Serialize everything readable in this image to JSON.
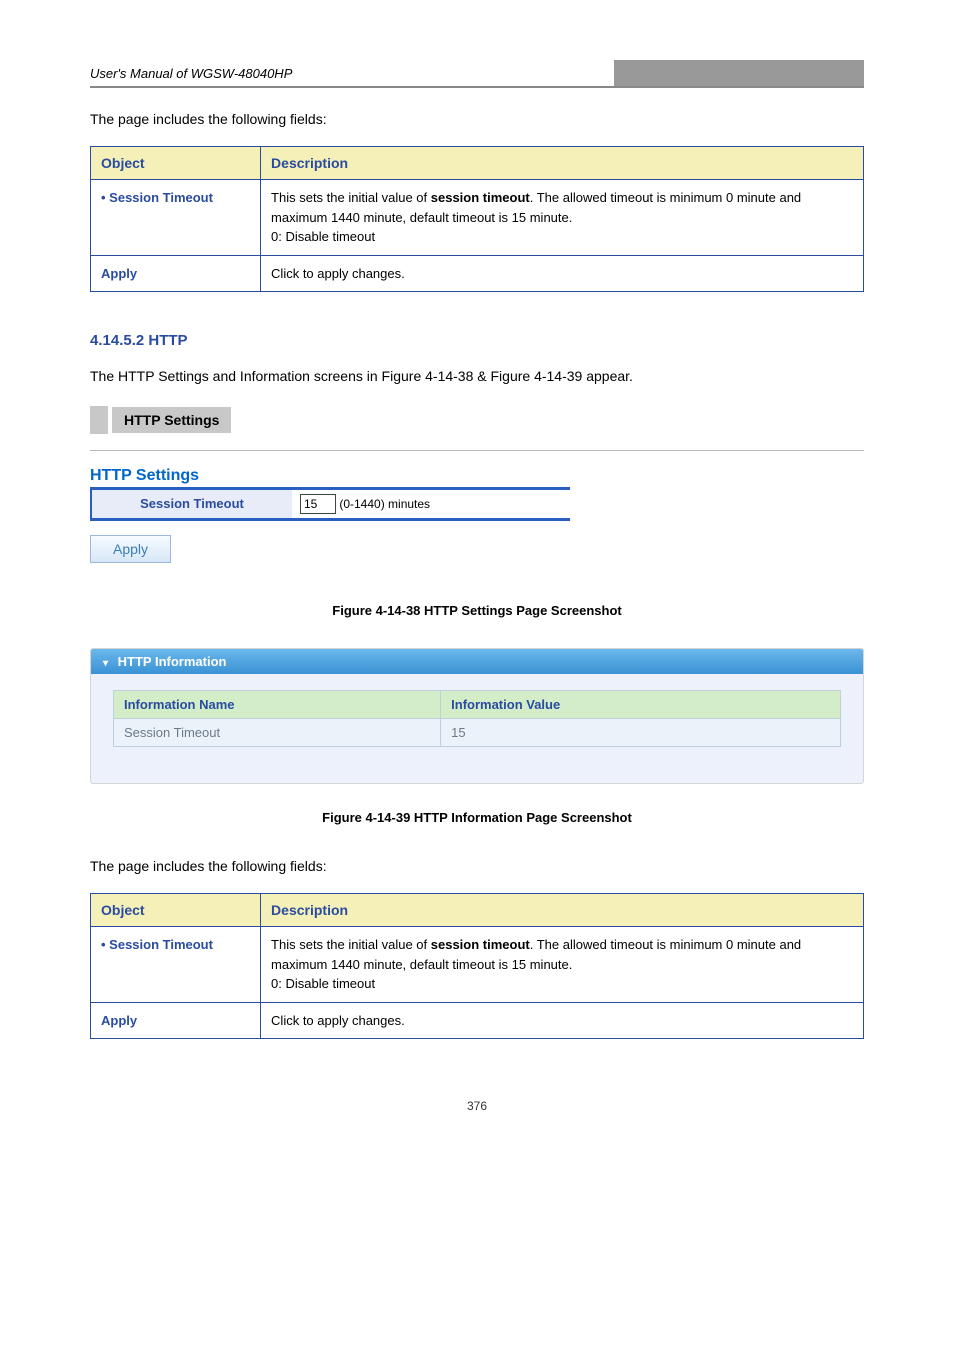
{
  "header": {
    "left_italic": "User's Manual of WGSW-48040HP",
    "right_bar": ""
  },
  "para_intro": "The page includes the following fields:",
  "table1": {
    "headers": [
      "Object",
      "Description"
    ],
    "rows": [
      {
        "object": "• Session Timeout",
        "desc_prefix": "This sets the initial value of ",
        "desc_bold": "session timeout",
        "desc_suffix": ". The allowed timeout is minimum 0 minute and maximum 1440 minute, default timeout is 15 minute.",
        "desc_line2": "0: Disable timeout"
      },
      {
        "object": "Apply",
        "desc_prefix": "Click to apply changes.",
        "desc_bold": "",
        "desc_suffix": "",
        "desc_line2": ""
      }
    ]
  },
  "section_num": "4.14.5.2 HTTP",
  "section_para": "The HTTP Settings and Information screens in Figure 4-14-38 & Figure 4-14-39 appear.",
  "breadcrumb": "HTTP Settings",
  "panel": {
    "title": "HTTP Settings",
    "row_label": "Session Timeout",
    "input_value": "15",
    "input_suffix": "(0-1440) minutes",
    "apply_label": "Apply"
  },
  "figure1_caption": "Figure 4-14-38 HTTP Settings Page Screenshot",
  "infocard": {
    "header": "HTTP Information",
    "table": {
      "headers": [
        "Information Name",
        "Information Value"
      ],
      "row": {
        "name": "Session Timeout",
        "value": "15"
      }
    }
  },
  "figure2_caption": "Figure 4-14-39 HTTP Information Page Screenshot",
  "para_fields2": "The page includes the following fields:",
  "table2": {
    "headers": [
      "Object",
      "Description"
    ],
    "rows": [
      {
        "object": "• Session Timeout",
        "desc_prefix": "This sets the initial value of ",
        "desc_bold": "session timeout",
        "desc_suffix": ". The allowed timeout is minimum 0 minute and maximum 1440 minute, default timeout is 15 minute.",
        "desc_line2": "0: Disable timeout"
      },
      {
        "object": "Apply",
        "desc_prefix": "Click to apply changes.",
        "desc_bold": "",
        "desc_suffix": "",
        "desc_line2": ""
      }
    ]
  },
  "page_number": "376"
}
